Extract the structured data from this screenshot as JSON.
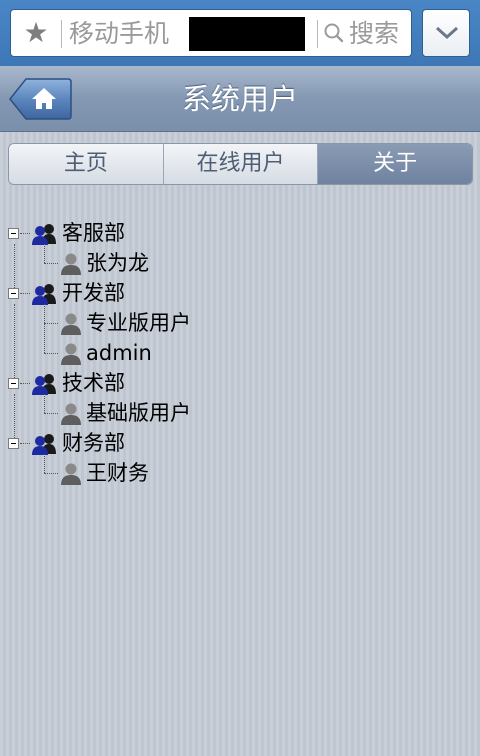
{
  "browser": {
    "address_text": "移动手机",
    "search_label": "搜索"
  },
  "header": {
    "title": "系统用户"
  },
  "tabs": [
    {
      "label": "主页",
      "active": false
    },
    {
      "label": "在线用户",
      "active": false
    },
    {
      "label": "关于",
      "active": true
    }
  ],
  "tree": {
    "departments": [
      {
        "name": "客服部",
        "users": [
          "张为龙"
        ]
      },
      {
        "name": "开发部",
        "users": [
          "专业版用户",
          "admin"
        ]
      },
      {
        "name": "技术部",
        "users": [
          "基础版用户"
        ]
      },
      {
        "name": "财务部",
        "users": [
          "王财务"
        ]
      }
    ]
  },
  "colors": {
    "browser_bar": "#4a86c5",
    "header": "#8498b3",
    "tab_active": "#7a8daa",
    "background": "#c5ccd5"
  }
}
